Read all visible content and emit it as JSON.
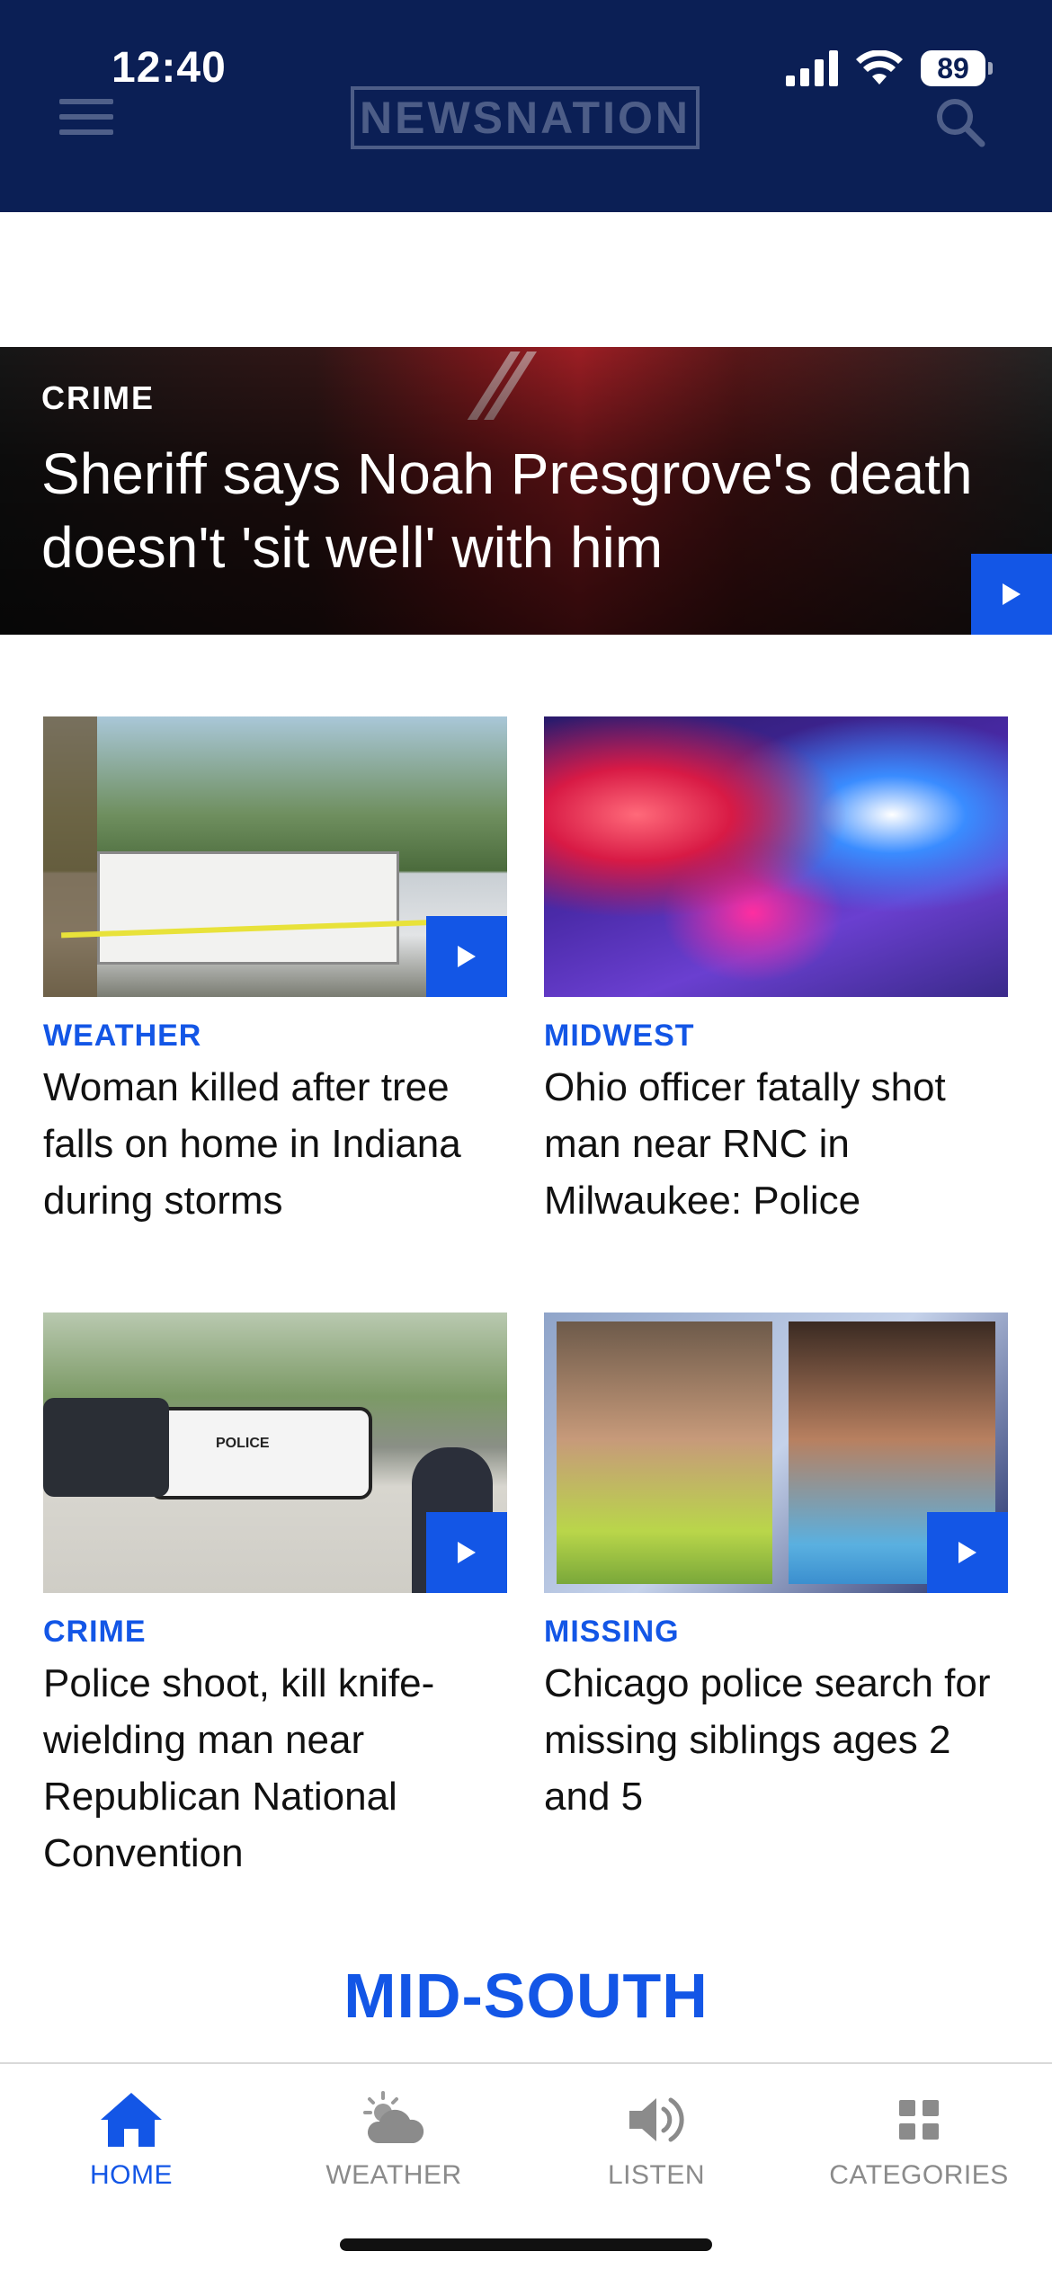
{
  "status_bar": {
    "time": "12:40",
    "battery": "89"
  },
  "header": {
    "logo_text": "NEWSNATION"
  },
  "hero": {
    "category": "CRIME",
    "title": "Sheriff says Noah Presgrove's death doesn't 'sit well' with him"
  },
  "cards": [
    {
      "category": "WEATHER",
      "title": "Woman killed after tree falls on home in Indiana during storms"
    },
    {
      "category": "MIDWEST",
      "title": "Ohio officer fatally shot man near RNC in Milwaukee: Police"
    },
    {
      "category": "CRIME",
      "title": "Police shoot, kill knife-wielding man near Republican National Convention",
      "thumb_text": "POLICE"
    },
    {
      "category": "MISSING",
      "title": "Chicago police search for missing siblings ages 2 and 5"
    }
  ],
  "section_title": "MID-SOUTH",
  "tabbar": {
    "items": [
      {
        "label": "HOME",
        "icon": "home-icon",
        "active": true
      },
      {
        "label": "WEATHER",
        "icon": "weather-icon",
        "active": false
      },
      {
        "label": "LISTEN",
        "icon": "speaker-icon",
        "active": false
      },
      {
        "label": "CATEGORIES",
        "icon": "grid-icon",
        "active": false
      }
    ]
  },
  "colors": {
    "header_bg": "#0b1f55",
    "accent": "#1356e6",
    "inactive": "#8b8b8b"
  }
}
